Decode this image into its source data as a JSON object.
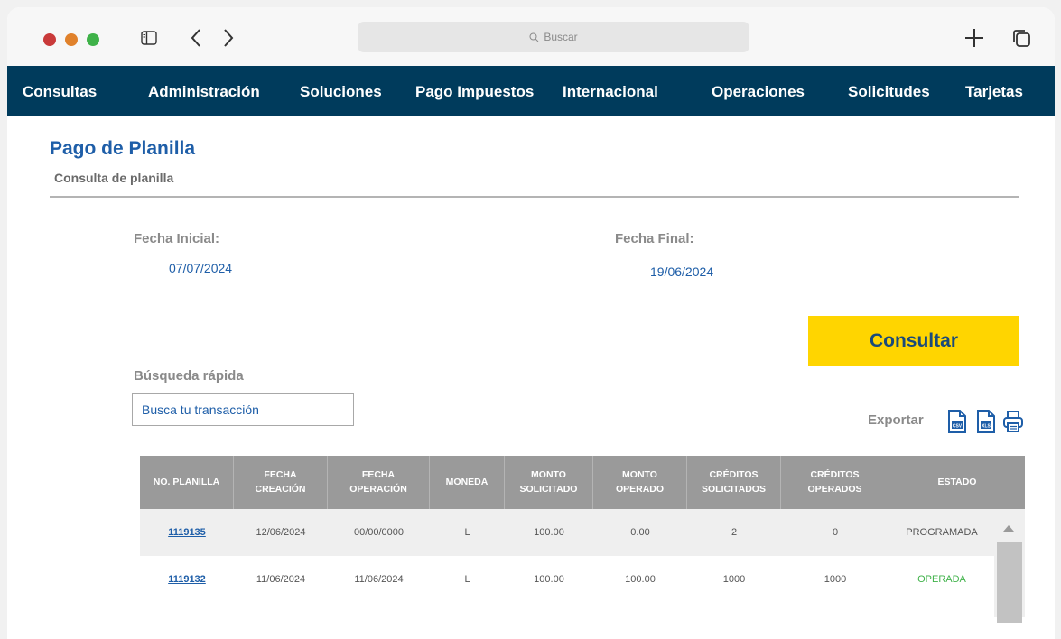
{
  "browser": {
    "search_placeholder": "Buscar"
  },
  "nav": {
    "items": [
      {
        "label": "Consultas"
      },
      {
        "label": "Administración"
      },
      {
        "label": "Soluciones"
      },
      {
        "label": "Pago Impuestos"
      },
      {
        "label": "Internacional"
      },
      {
        "label": "Operaciones"
      },
      {
        "label": "Solicitudes"
      },
      {
        "label": "Tarjetas"
      }
    ]
  },
  "page": {
    "title": "Pago de Planilla",
    "subtitle": "Consulta de planilla"
  },
  "filters": {
    "start_label": "Fecha Inicial:",
    "start_value": "07/07/2024",
    "end_label": "Fecha Final:",
    "end_value": "19/06/2024",
    "consult_label": "Consultar",
    "quick_label": "Búsqueda rápida",
    "quick_placeholder": "Busca tu transacción"
  },
  "export": {
    "label": "Exportar",
    "csv": "CSV",
    "xls": "XLS"
  },
  "table": {
    "headers": [
      [
        "NO. PLANILLA"
      ],
      [
        "FECHA",
        "CREACIÓN"
      ],
      [
        "FECHA",
        "OPERACIÓN"
      ],
      [
        "MONEDA"
      ],
      [
        "MONTO",
        "SOLICITADO"
      ],
      [
        "MONTO",
        "OPERADO"
      ],
      [
        "CRÉDITOS",
        "SOLICITADOS"
      ],
      [
        "CRÉDITOS",
        "OPERADOS"
      ],
      [
        "ESTADO"
      ]
    ],
    "rows": [
      {
        "planilla": "1119135",
        "creacion": "12/06/2024",
        "operacion": "00/00/0000",
        "moneda": "L",
        "monto_solicitado": "100.00",
        "monto_operado": "0.00",
        "creditos_solicitados": "2",
        "creditos_operados": "0",
        "estado": "PROGRAMADA"
      },
      {
        "planilla": "1119132",
        "creacion": "11/06/2024",
        "operacion": "11/06/2024",
        "moneda": "L",
        "monto_solicitado": "100.00",
        "monto_operado": "100.00",
        "creditos_solicitados": "1000",
        "creditos_operados": "1000",
        "estado": "OPERADA"
      }
    ]
  },
  "colors": {
    "nav_bg": "#003b5c",
    "accent_blue": "#1e5ea8",
    "button_yellow": "#ffd500",
    "status_green": "#3fb249",
    "header_gray": "#9a9a9a"
  }
}
